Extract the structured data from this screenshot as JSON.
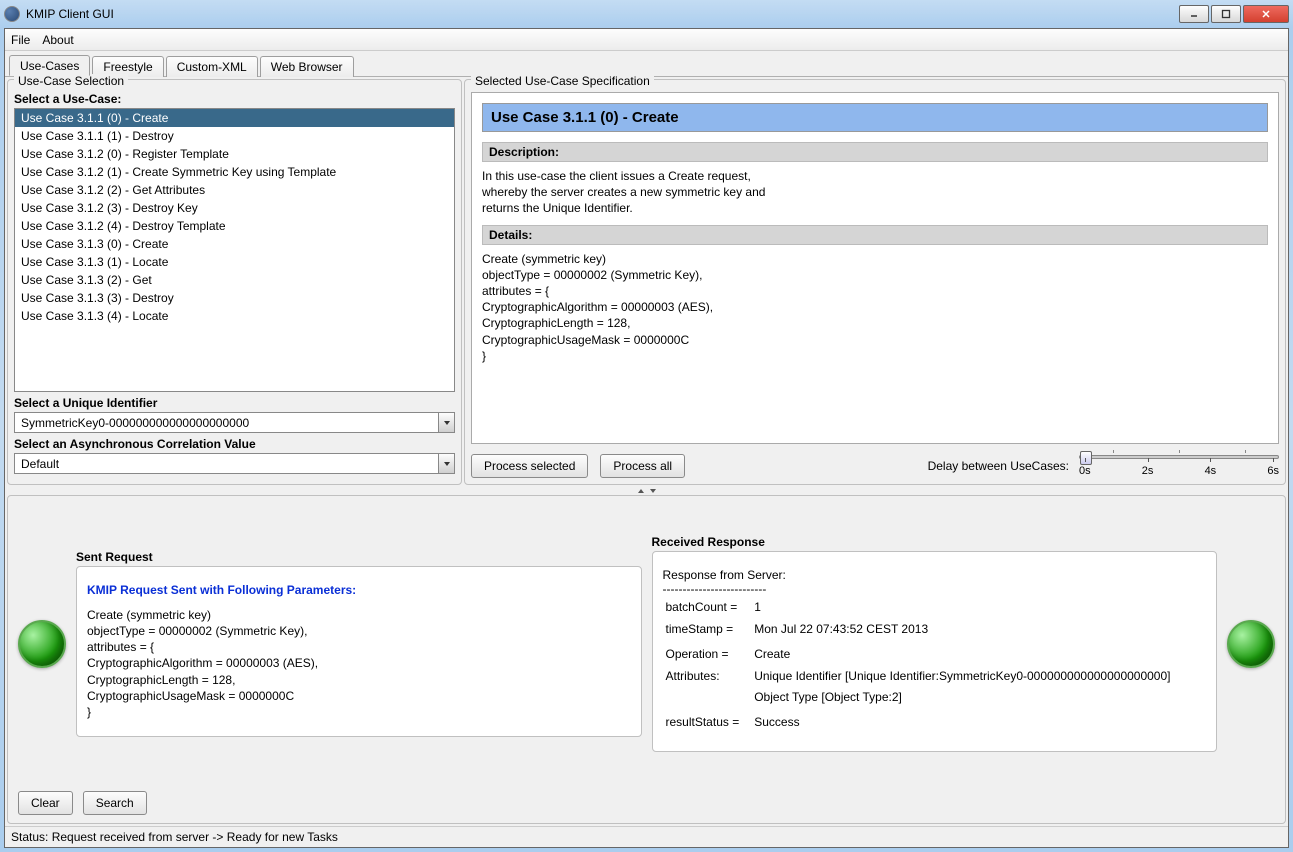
{
  "window": {
    "title": "KMIP Client GUI"
  },
  "menu": {
    "file": "File",
    "about": "About"
  },
  "tabs": {
    "usecases": "Use-Cases",
    "freestyle": "Freestyle",
    "customxml": "Custom-XML",
    "webbrowser": "Web Browser"
  },
  "left_panel": {
    "title": "Use-Case Selection",
    "select_uc_label": "Select a Use-Case:",
    "use_cases": [
      "Use Case 3.1.1 (0) - Create",
      "Use Case 3.1.1 (1) - Destroy",
      "Use Case 3.1.2 (0) - Register Template",
      "Use Case 3.1.2 (1) - Create Symmetric Key using Template",
      "Use Case 3.1.2 (2) - Get Attributes",
      "Use Case 3.1.2 (3) - Destroy Key",
      "Use Case 3.1.2 (4) - Destroy Template",
      "Use Case 3.1.3 (0) - Create",
      "Use Case 3.1.3 (1) - Locate",
      "Use Case 3.1.3 (2) - Get",
      "Use Case 3.1.3 (3) - Destroy",
      "Use Case 3.1.3 (4) - Locate"
    ],
    "uid_label": "Select a Unique Identifier",
    "uid_value": "SymmetricKey0-000000000000000000000",
    "async_label": "Select an Asynchronous Correlation Value",
    "async_value": "Default"
  },
  "right_panel": {
    "title": "Selected Use-Case Specification",
    "spec_title": "Use Case 3.1.1 (0) - Create",
    "desc_header": "Description:",
    "description": "In this use-case the client issues a Create request,\nwhereby the server creates a new symmetric key and\nreturns the Unique Identifier.",
    "details_header": "Details:",
    "details": "Create (symmetric key)\nobjectType = 00000002 (Symmetric Key),\nattributes = {\nCryptographicAlgorithm = 00000003 (AES),\nCryptographicLength = 128,\nCryptographicUsageMask = 0000000C\n}",
    "process_selected": "Process selected",
    "process_all": "Process all",
    "delay_label": "Delay between UseCases:",
    "slider_ticks": [
      "0s",
      "2s",
      "4s",
      "6s"
    ]
  },
  "sent": {
    "title": "Sent Request",
    "heading": "KMIP Request Sent with Following Parameters:",
    "body": "Create (symmetric key)\nobjectType = 00000002 (Symmetric Key),\nattributes = {\nCryptographicAlgorithm = 00000003 (AES),\nCryptographicLength = 128,\nCryptographicUsageMask = 0000000C\n}"
  },
  "received": {
    "title": "Received Response",
    "heading": "Response from Server:",
    "rows": [
      [
        "batchCount =",
        "1"
      ],
      [
        "timeStamp =",
        "Mon Jul 22 07:43:52 CEST 2013"
      ],
      [
        "",
        ""
      ],
      [
        "Operation =",
        "Create"
      ],
      [
        "Attributes:",
        "Unique Identifier [Unique Identifier:SymmetricKey0-000000000000000000000]"
      ],
      [
        "",
        "Object Type [Object Type:2]"
      ],
      [
        "",
        ""
      ],
      [
        "resultStatus =",
        "Success"
      ]
    ]
  },
  "buttons": {
    "clear": "Clear",
    "search": "Search"
  },
  "status": "Status: Request received from server -> Ready for new Tasks"
}
